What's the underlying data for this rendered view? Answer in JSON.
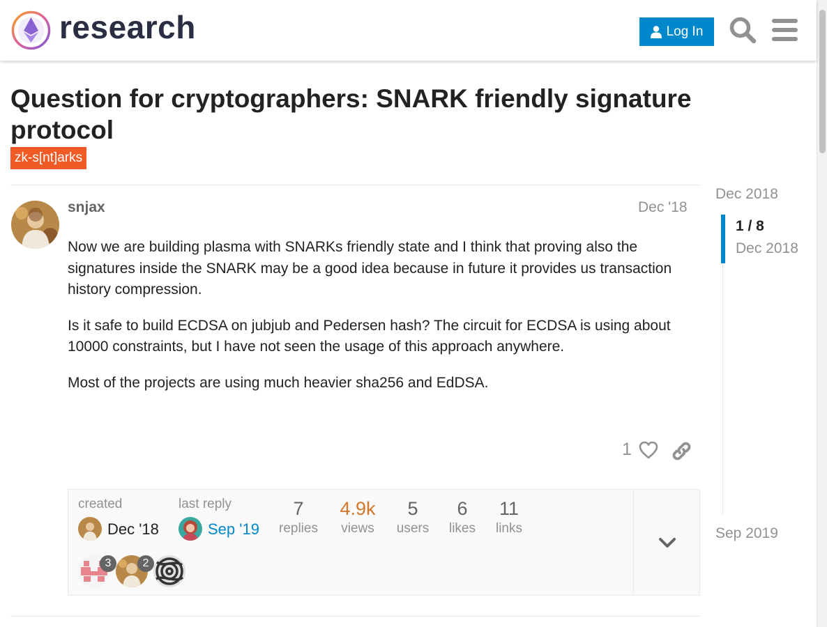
{
  "header": {
    "site_name": "research",
    "login_label": "Log In"
  },
  "topic": {
    "title_line1": "Question for cryptographers: SNARK friendly signature",
    "title_line2": "protocol",
    "tag": "zk-s[nt]arks"
  },
  "post": {
    "username": "snjax",
    "date": "Dec '18",
    "paragraphs": [
      "Now we are building plasma with SNARKs friendly state and I think that proving also the signatures inside the SNARK may be a good idea because in future it provides us transaction history compression.",
      "Is it safe to build ECDSA on jubjub and Pedersen hash? The circuit for ECDSA is using about 10000 constraints, but I have not seen the usage of this approach anywhere.",
      "Most of the projects are using much heavier sha256 and EdDSA."
    ],
    "likes": "1"
  },
  "topic_map": {
    "created_label": "created",
    "created_date": "Dec '18",
    "last_reply_label": "last reply",
    "last_reply_date": "Sep '19",
    "stats": [
      {
        "num": "7",
        "label": "replies"
      },
      {
        "num": "4.9k",
        "label": "views"
      },
      {
        "num": "5",
        "label": "users"
      },
      {
        "num": "6",
        "label": "likes"
      },
      {
        "num": "11",
        "label": "links"
      }
    ],
    "participants": [
      {
        "count": "3"
      },
      {
        "count": "2"
      },
      {
        "count": ""
      }
    ]
  },
  "timeline": {
    "top_date": "Dec 2018",
    "position": "1 / 8",
    "current_date": "Dec 2018",
    "bottom_date": "Sep 2019"
  },
  "colors": {
    "accent": "#0088cc",
    "tag": "#f15a24",
    "views_highlight": "#d4782c"
  }
}
